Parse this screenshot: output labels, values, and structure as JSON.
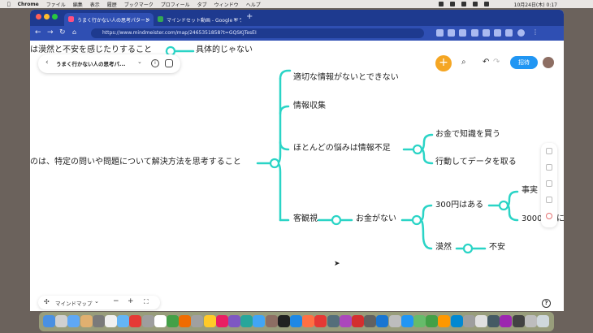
{
  "menubar": {
    "app": "Chrome",
    "items": [
      "ファイル",
      "編集",
      "表示",
      "履歴",
      "ブックマーク",
      "プロフィール",
      "タブ",
      "ウィンドウ",
      "ヘルプ"
    ],
    "clock": "10月24日(木) 0:17"
  },
  "browser": {
    "tabs": [
      {
        "label": "うまく行かない人の思考パターン",
        "active": true,
        "favicon_color": "#ff4f81"
      },
      {
        "label": "マインドセット動画 - Google ドライブ",
        "active": false,
        "favicon_color": "#34a853"
      }
    ],
    "new_tab": "+",
    "url": "https://www.mindmeister.com/map/2465351858?t=GQSKJTesEI"
  },
  "map_toolbar": {
    "back": "‹",
    "title": "うまく行かない人の思考パ...",
    "dropdown": "⌄",
    "info_icon": "i",
    "add_button": "+",
    "invite_button": "招待"
  },
  "mindmap": {
    "top_partial_left": "は漠然と不安を感じたりすること",
    "top_partial_right": "具体的じゃない",
    "root": "のは、特定の問いや問題について解決方法を思考すること",
    "branches": {
      "b1": "適切な情報がないとできない",
      "b2": "情報収集",
      "b3": "ほとんどの悩みは情報不足",
      "b3a": "お金で知識を買う",
      "b3b": "行動してデータを取る",
      "b4": "客観視",
      "b4a": "お金がない",
      "b4a1": "300円はある",
      "b4a1a": "事実",
      "b4a1b": "3000",
      "b4a1b_suffix": "に",
      "b4a2": "漠然",
      "b4a2a": "不安"
    },
    "line_color": "#2ad4c6"
  },
  "bottom_toolbar": {
    "mode_label": "マインドマップ",
    "zoom_out": "−",
    "zoom_in": "+",
    "help": "?"
  },
  "dock_colors": [
    "#4a90e2",
    "#d0d0d0",
    "#5fa8f5",
    "#e0b070",
    "#7a7a7a",
    "#f0f0f0",
    "#64b5f6",
    "#e53935",
    "#9e9e9e",
    "#ffffff",
    "#43a047",
    "#ef6c00",
    "#a0a0a0",
    "#ffca28",
    "#e91e63",
    "#7e57c2",
    "#26a69a",
    "#42a5f5",
    "#8d6e63",
    "#212121",
    "#1e88e5",
    "#ff7043",
    "#e53935",
    "#546e7a",
    "#ab47bc",
    "#d32f2f",
    "#616161",
    "#1976d2",
    "#bdbdbd",
    "#2196f3",
    "#66bb6a",
    "#43a047",
    "#ff9800",
    "#0288d1",
    "#9e9e9e",
    "#e0e0e0",
    "#455a64",
    "#9c27b0",
    "#424242",
    "#bdbdbd",
    "#cfd8dc"
  ]
}
